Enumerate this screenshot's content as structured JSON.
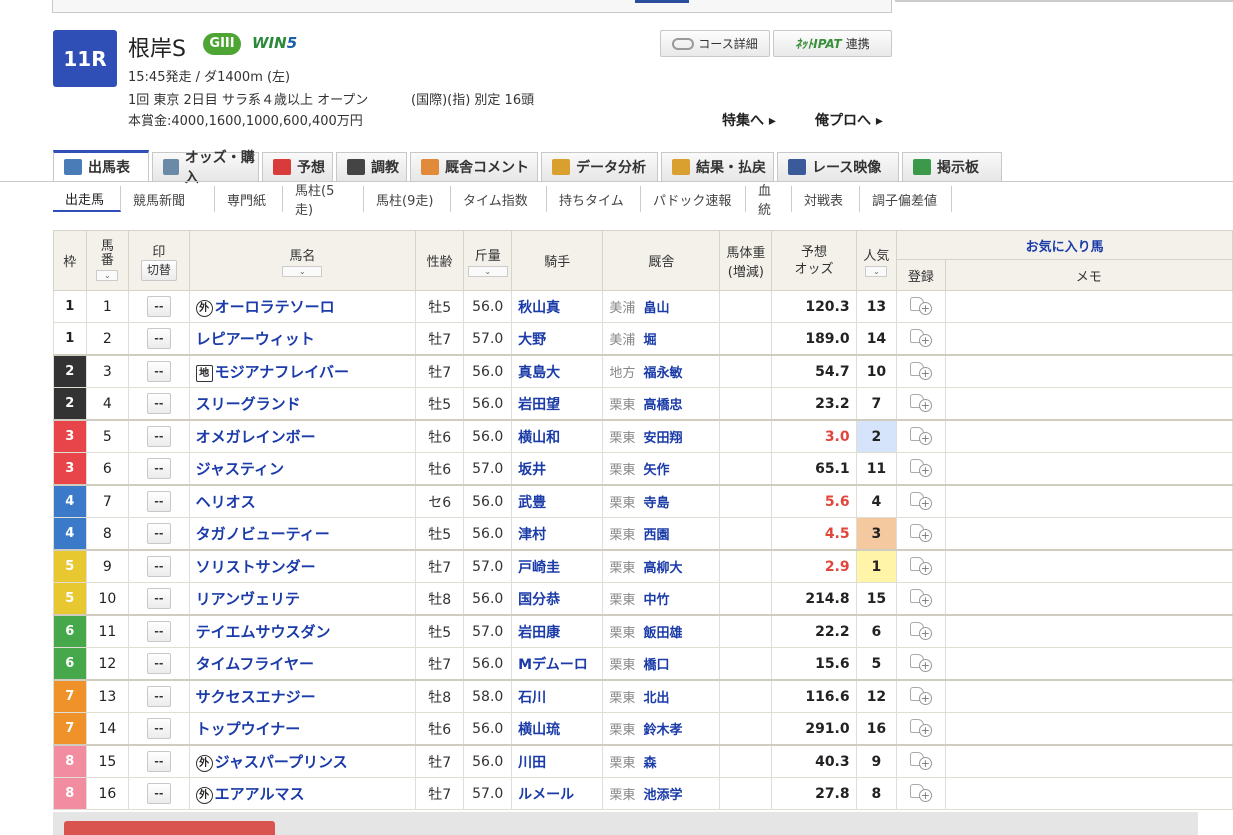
{
  "race": {
    "number": "11R",
    "name": "根岸S",
    "grade": "GIII",
    "win5": "WIN",
    "win5_num": "5",
    "line1": "15:45発走 / ダ1400m (左)",
    "line2a": "1回 東京 2日目 サラ系４歳以上 オープン",
    "line2b": "(国際)(指) 別定 16頭",
    "line3": "本賞金:4000,1600,1000,600,400万円"
  },
  "buttons": {
    "course": "コース詳細",
    "ipat": "ﾈｯﾄIPAT",
    "ipat_link": "連携",
    "tokushu": "特集へ",
    "orepro": "俺プロへ"
  },
  "tabs": [
    {
      "label": "出馬表",
      "icon": "table-icon",
      "color": "#4a7db8"
    },
    {
      "label": "オッズ・購入",
      "icon": "ticket-icon",
      "color": "#6a8aa8"
    },
    {
      "label": "予想",
      "icon": "target-icon",
      "color": "#d93a3a"
    },
    {
      "label": "調教",
      "icon": "stopwatch-icon",
      "color": "#444444"
    },
    {
      "label": "厩舎コメント",
      "icon": "stable-icon",
      "color": "#e08a3a"
    },
    {
      "label": "データ分析",
      "icon": "bar-chart-icon",
      "color": "#d9a030"
    },
    {
      "label": "結果・払戻",
      "icon": "coins-icon",
      "color": "#d9a030"
    },
    {
      "label": "レース映像",
      "icon": "video-icon",
      "color": "#3a5a9a"
    },
    {
      "label": "掲示板",
      "icon": "chat-icon",
      "color": "#3a9a4a"
    }
  ],
  "subtabs": [
    "出走馬",
    "競馬新聞",
    "専門紙",
    "馬柱(5走)",
    "馬柱(9走)",
    "タイム指数",
    "持ちタイム",
    "パドック速報",
    "血統",
    "対戦表",
    "調子偏差値"
  ],
  "headers": {
    "waku": "枠",
    "umaban": "馬\n番",
    "mark": "印",
    "mark_toggle": "切替",
    "name": "馬名",
    "age": "性齢",
    "weight": "斤量",
    "jockey": "騎手",
    "trainer": "厩舎",
    "bodyweight": "馬体重",
    "bodyweight_sub": "(増減)",
    "odds": "予想\nオッズ",
    "pop": "人気",
    "fav": "お気に入り馬",
    "reg": "登録",
    "memo": "メモ"
  },
  "mark_value": "--",
  "waku_colors": {
    "1": {
      "bg": "#ffffff",
      "fg": "#222222"
    },
    "2": {
      "bg": "#333333",
      "fg": "#ffffff"
    },
    "3": {
      "bg": "#e8454a",
      "fg": "#ffffff"
    },
    "4": {
      "bg": "#3a7ac8",
      "fg": "#ffffff"
    },
    "5": {
      "bg": "#e8c830",
      "fg": "#ffffff"
    },
    "6": {
      "bg": "#46a84a",
      "fg": "#ffffff"
    },
    "7": {
      "bg": "#f0922a",
      "fg": "#ffffff"
    },
    "8": {
      "bg": "#f28ca0",
      "fg": "#ffffff"
    }
  },
  "horses": [
    {
      "waku": "1",
      "num": "1",
      "tag": "外",
      "name": "オーロラテソーロ",
      "age": "牡5",
      "wt": "56.0",
      "jockey": "秋山真",
      "region": "美浦",
      "trainer": "畠山",
      "odds": "120.3",
      "pop": "13"
    },
    {
      "waku": "1",
      "num": "2",
      "tag": "",
      "name": "レピアーウィット",
      "age": "牡7",
      "wt": "57.0",
      "jockey": "大野",
      "region": "美浦",
      "trainer": "堀",
      "odds": "189.0",
      "pop": "14"
    },
    {
      "waku": "2",
      "num": "3",
      "tag": "地",
      "name": "モジアナフレイバー",
      "age": "牡7",
      "wt": "56.0",
      "jockey": "真島大",
      "region": "地方",
      "trainer": "福永敏",
      "odds": "54.7",
      "pop": "10"
    },
    {
      "waku": "2",
      "num": "4",
      "tag": "",
      "name": "スリーグランド",
      "age": "牡5",
      "wt": "56.0",
      "jockey": "岩田望",
      "region": "栗東",
      "trainer": "高橋忠",
      "odds": "23.2",
      "pop": "7"
    },
    {
      "waku": "3",
      "num": "5",
      "tag": "",
      "name": "オメガレインボー",
      "age": "牡6",
      "wt": "56.0",
      "jockey": "横山和",
      "region": "栗東",
      "trainer": "安田翔",
      "odds": "3.0",
      "pop": "2"
    },
    {
      "waku": "3",
      "num": "6",
      "tag": "",
      "name": "ジャスティン",
      "age": "牡6",
      "wt": "57.0",
      "jockey": "坂井",
      "region": "栗東",
      "trainer": "矢作",
      "odds": "65.1",
      "pop": "11"
    },
    {
      "waku": "4",
      "num": "7",
      "tag": "",
      "name": "ヘリオス",
      "age": "セ6",
      "wt": "56.0",
      "jockey": "武豊",
      "region": "栗東",
      "trainer": "寺島",
      "odds": "5.6",
      "pop": "4"
    },
    {
      "waku": "4",
      "num": "8",
      "tag": "",
      "name": "タガノビューティー",
      "age": "牡5",
      "wt": "56.0",
      "jockey": "津村",
      "region": "栗東",
      "trainer": "西園",
      "odds": "4.5",
      "pop": "3"
    },
    {
      "waku": "5",
      "num": "9",
      "tag": "",
      "name": "ソリストサンダー",
      "age": "牡7",
      "wt": "57.0",
      "jockey": "戸崎圭",
      "region": "栗東",
      "trainer": "高柳大",
      "odds": "2.9",
      "pop": "1"
    },
    {
      "waku": "5",
      "num": "10",
      "tag": "",
      "name": "リアンヴェリテ",
      "age": "牡8",
      "wt": "56.0",
      "jockey": "国分恭",
      "region": "栗東",
      "trainer": "中竹",
      "odds": "214.8",
      "pop": "15"
    },
    {
      "waku": "6",
      "num": "11",
      "tag": "",
      "name": "テイエムサウスダン",
      "age": "牡5",
      "wt": "57.0",
      "jockey": "岩田康",
      "region": "栗東",
      "trainer": "飯田雄",
      "odds": "22.2",
      "pop": "6"
    },
    {
      "waku": "6",
      "num": "12",
      "tag": "",
      "name": "タイムフライヤー",
      "age": "牡7",
      "wt": "56.0",
      "jockey": "Mデムーロ",
      "region": "栗東",
      "trainer": "橋口",
      "odds": "15.6",
      "pop": "5"
    },
    {
      "waku": "7",
      "num": "13",
      "tag": "",
      "name": "サクセスエナジー",
      "age": "牡8",
      "wt": "58.0",
      "jockey": "石川",
      "region": "栗東",
      "trainer": "北出",
      "odds": "116.6",
      "pop": "12"
    },
    {
      "waku": "7",
      "num": "14",
      "tag": "",
      "name": "トップウイナー",
      "age": "牡6",
      "wt": "56.0",
      "jockey": "横山琉",
      "region": "栗東",
      "trainer": "鈴木孝",
      "odds": "291.0",
      "pop": "16"
    },
    {
      "waku": "8",
      "num": "15",
      "tag": "外",
      "name": "ジャスパープリンス",
      "age": "牡7",
      "wt": "56.0",
      "jockey": "川田",
      "region": "栗東",
      "trainer": "森",
      "odds": "40.3",
      "pop": "9"
    },
    {
      "waku": "8",
      "num": "16",
      "tag": "外",
      "name": "エアアルマス",
      "age": "牡7",
      "wt": "57.0",
      "jockey": "ルメール",
      "region": "栗東",
      "trainer": "池添学",
      "odds": "27.8",
      "pop": "8"
    }
  ],
  "pop_highlight": {
    "1": "#fff4a8",
    "2": "#d6e4fb",
    "3": "#f5c9a0"
  },
  "red_odds_threshold": 10
}
